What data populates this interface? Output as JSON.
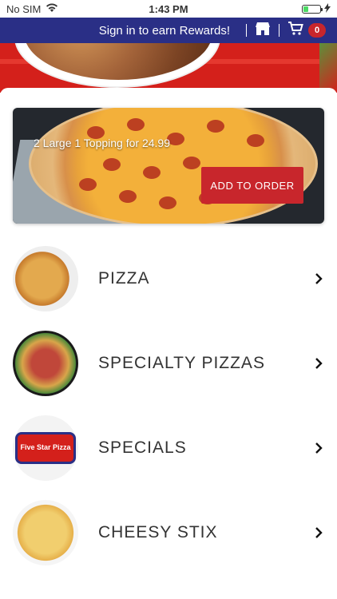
{
  "status_bar": {
    "carrier": "No SIM",
    "time": "1:43 PM"
  },
  "navbar": {
    "signin": "Sign in to earn Rewards!",
    "cart_count": "0",
    "store_icon": "store-icon",
    "cart_icon": "cart-icon"
  },
  "promo": {
    "text": "2 Large 1 Topping for 24.99",
    "button": "ADD TO ORDER"
  },
  "menu": [
    {
      "label": "PIZZA"
    },
    {
      "label": "SPECIALTY PIZZAS"
    },
    {
      "label": "SPECIALS",
      "logo": "Five Star Pizza"
    },
    {
      "label": "CHEESY STIX"
    }
  ],
  "colors": {
    "nav": "#2a2f86",
    "accent": "#c8262c"
  }
}
